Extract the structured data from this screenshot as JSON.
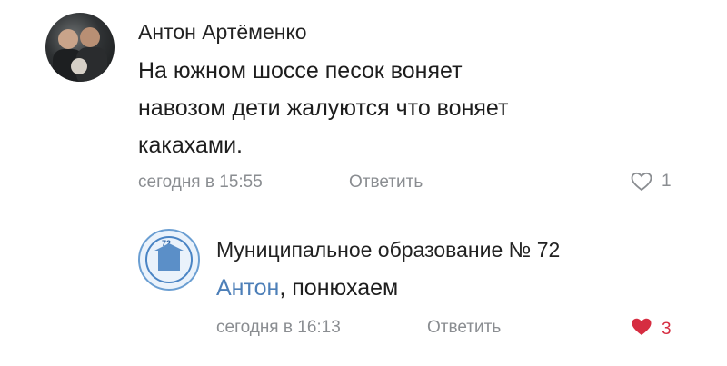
{
  "comments": [
    {
      "author": "Антон Артёменко",
      "text": "На южном шоссе песок воняет\nнавозом дети жалуются что воняет\nкакахами.",
      "date": "сегодня в 15:55",
      "reply_label": "Ответить",
      "likes": "1",
      "liked": false
    },
    {
      "author": "Муниципальное образование № 72",
      "mention": "Антон",
      "text_after_mention": ", понюхаем",
      "date": "сегодня в 16:13",
      "reply_label": "Ответить",
      "likes": "3",
      "liked": true,
      "avatar_badge": "72"
    }
  ],
  "icons": {
    "like_outline": "heart-outline-icon",
    "like_filled": "heart-filled-icon"
  },
  "colors": {
    "mention": "#4d7fb8",
    "liked_heart": "#d62d41",
    "meta": "#8a8d91"
  }
}
